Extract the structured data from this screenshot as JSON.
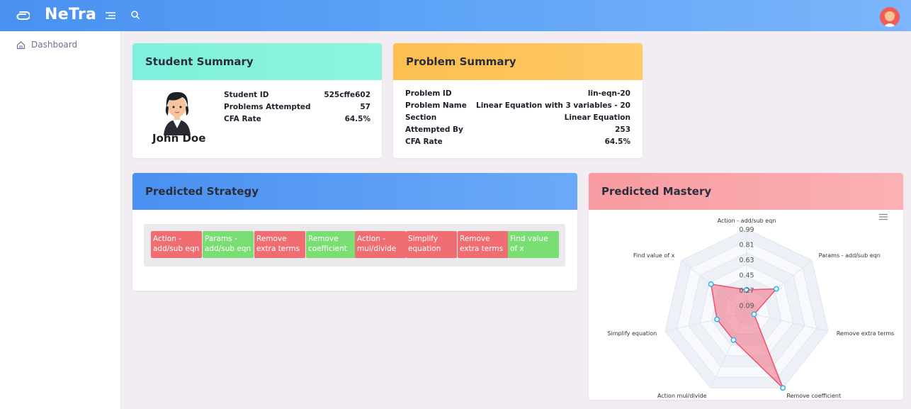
{
  "app": {
    "name": "NeTra"
  },
  "colors": {
    "topbar": "#4a90f0",
    "chip_red": "#f06e72",
    "chip_green": "#7bde74",
    "radar_fill": "#f06e80"
  },
  "sidebar": {
    "items": [
      {
        "label": "Dashboard",
        "icon": "home-icon"
      }
    ]
  },
  "student_summary": {
    "title": "Student Summary",
    "name": "John Doe",
    "fields": [
      {
        "label": "Student ID",
        "value": "525cffe602"
      },
      {
        "label": "Problems Attempted",
        "value": "57"
      },
      {
        "label": "CFA Rate",
        "value": "64.5%"
      }
    ]
  },
  "problem_summary": {
    "title": "Problem Summary",
    "fields": [
      {
        "label": "Problem ID",
        "value": "lin-eqn-20"
      },
      {
        "label": "Problem Name",
        "value": "Linear Equation with 3 variables - 20"
      },
      {
        "label": "Section",
        "value": "Linear Equation"
      },
      {
        "label": "Attempted By",
        "value": "253"
      },
      {
        "label": "CFA Rate",
        "value": "64.5%"
      }
    ]
  },
  "predicted_strategy": {
    "title": "Predicted Strategy",
    "steps": [
      {
        "label": "Action - add/sub eqn",
        "status": "red"
      },
      {
        "label": "Params - add/sub eqn",
        "status": "green"
      },
      {
        "label": "Remove extra terms",
        "status": "red"
      },
      {
        "label": "Remove coefficient",
        "status": "green"
      },
      {
        "label": "Action - mul/divide",
        "status": "red"
      },
      {
        "label": "Simplify equation",
        "status": "red"
      },
      {
        "label": "Remove extra terms",
        "status": "red"
      },
      {
        "label": "Find value of x",
        "status": "green"
      }
    ]
  },
  "predicted_mastery": {
    "title": "Predicted Mastery"
  },
  "chart_data": {
    "type": "radar",
    "axes": [
      "Action - add/sub eqn",
      "Params - add/sub eqn",
      "Remove extra terms",
      "Remove coefficient",
      "Action mul/divide",
      "Simplify equation",
      "Find value of x"
    ],
    "values": [
      0.27,
      0.45,
      0.09,
      0.99,
      0.36,
      0.36,
      0.54
    ],
    "tick_labels": [
      "0.99",
      "0.81",
      "0.63",
      "0.45",
      "0.27",
      "0.09"
    ],
    "rmax": 0.99
  }
}
